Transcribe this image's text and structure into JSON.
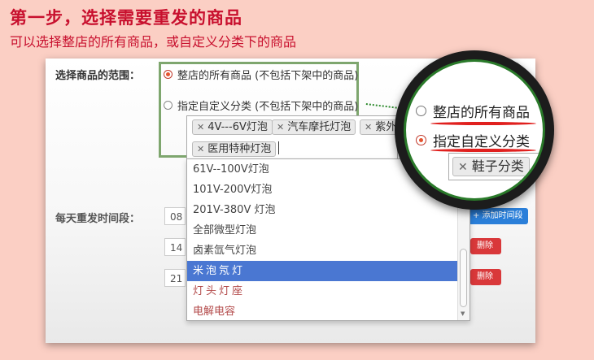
{
  "header": {
    "title": "第一步，选择需要重发的商品",
    "subtitle": "可以选择整店的所有商品，或自定义分类下的商品"
  },
  "form": {
    "scope_label": "选择商品的范围：",
    "option_all": "整店的所有商品 (不包括下架中的商品)",
    "option_custom": "指定自定义分类 (不包括下架中的商品)",
    "selected_option": "option_all",
    "chips": [
      "4V---6V灯泡",
      "汽车摩托灯泡",
      "紫外线",
      "医用特种灯泡"
    ],
    "dropdown_options": [
      "61V--100V灯泡",
      "101V-200V灯泡",
      "201V-380V 灯泡",
      "全部微型灯泡",
      "卤素氙气灯泡",
      "米泡氖灯",
      "灯头灯座",
      "电解电容"
    ],
    "highlighted_option": "米泡氖灯",
    "time_label": "每天重发时间段：",
    "time_values": [
      "08",
      "14",
      "21"
    ],
    "add_time_button": "+ 添加时间段",
    "delete_button": "删除"
  },
  "magnifier": {
    "option_all": "整店的所有商品",
    "option_custom": "指定自定义分类",
    "selected_option": "option_custom",
    "chip": "鞋子分类"
  },
  "colors": {
    "title_red": "#c8102e",
    "background": "#fbcfc4",
    "highlight_green": "#7ea66e",
    "selected_blue": "#4a77d2",
    "button_blue": "#2b7fd9",
    "button_red": "#d9383a"
  }
}
